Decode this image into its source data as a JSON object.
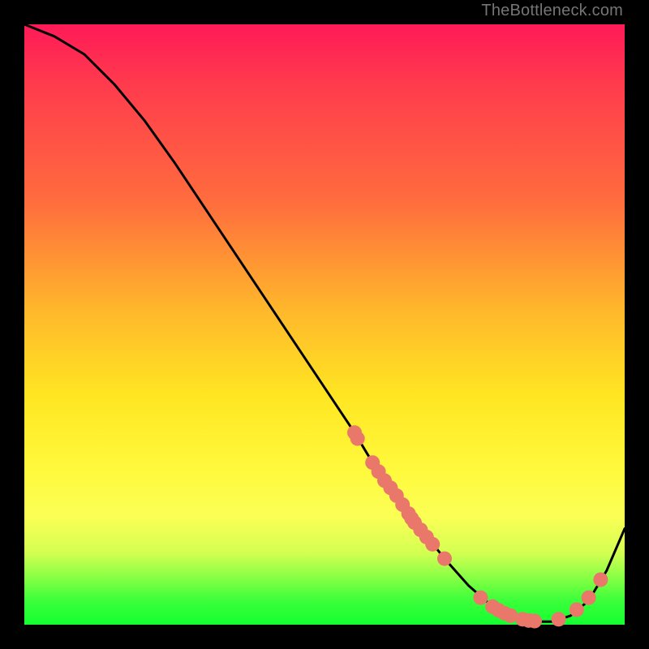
{
  "watermark": "TheBottleneck.com",
  "chart_data": {
    "type": "line",
    "title": "",
    "xlabel": "",
    "ylabel": "",
    "xlim": [
      0,
      100
    ],
    "ylim": [
      0,
      100
    ],
    "curve": {
      "x": [
        0,
        5,
        10,
        15,
        20,
        25,
        30,
        35,
        40,
        45,
        50,
        55,
        58,
        62,
        66,
        70,
        74,
        78,
        82,
        85,
        88,
        91,
        94,
        97,
        100
      ],
      "y": [
        100,
        98,
        95,
        90,
        84,
        77,
        69.5,
        62,
        54.5,
        47,
        39.5,
        32,
        27,
        21.5,
        16,
        11,
        6.5,
        3,
        1,
        0.5,
        0.5,
        1.5,
        4,
        9,
        16
      ]
    },
    "points": [
      {
        "x": 55,
        "y": 32
      },
      {
        "x": 55.5,
        "y": 31
      },
      {
        "x": 58,
        "y": 27
      },
      {
        "x": 59,
        "y": 25.5
      },
      {
        "x": 60,
        "y": 24
      },
      {
        "x": 61,
        "y": 22.8
      },
      {
        "x": 62,
        "y": 21.5
      },
      {
        "x": 63,
        "y": 20
      },
      {
        "x": 64,
        "y": 18.5
      },
      {
        "x": 64.5,
        "y": 17.7
      },
      {
        "x": 65,
        "y": 17
      },
      {
        "x": 66,
        "y": 15.8
      },
      {
        "x": 67,
        "y": 14.6
      },
      {
        "x": 68,
        "y": 13.4
      },
      {
        "x": 70,
        "y": 11
      },
      {
        "x": 76,
        "y": 4.5
      },
      {
        "x": 78,
        "y": 3
      },
      {
        "x": 79,
        "y": 2.4
      },
      {
        "x": 80,
        "y": 1.9
      },
      {
        "x": 81,
        "y": 1.5
      },
      {
        "x": 83,
        "y": 0.9
      },
      {
        "x": 84,
        "y": 0.7
      },
      {
        "x": 85,
        "y": 0.6
      },
      {
        "x": 89,
        "y": 0.9
      },
      {
        "x": 92,
        "y": 2.5
      },
      {
        "x": 94,
        "y": 4.5
      },
      {
        "x": 96,
        "y": 7.5
      }
    ],
    "point_color": "#e9776a",
    "curve_color": "#000000",
    "gradient_stops": [
      {
        "pos": 0,
        "color": "#ff1a58"
      },
      {
        "pos": 10,
        "color": "#ff3b4d"
      },
      {
        "pos": 30,
        "color": "#ff6e3d"
      },
      {
        "pos": 48,
        "color": "#ffb92b"
      },
      {
        "pos": 62,
        "color": "#ffe622"
      },
      {
        "pos": 74,
        "color": "#fff93c"
      },
      {
        "pos": 82,
        "color": "#fbff55"
      },
      {
        "pos": 88,
        "color": "#d4ff52"
      },
      {
        "pos": 92,
        "color": "#8aff45"
      },
      {
        "pos": 96,
        "color": "#3bff3a"
      },
      {
        "pos": 100,
        "color": "#14ff30"
      }
    ]
  }
}
